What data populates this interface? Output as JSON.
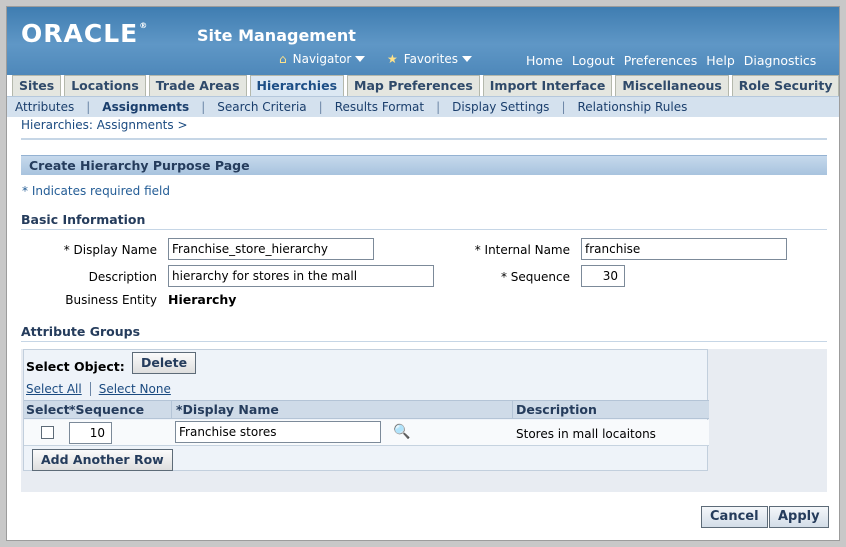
{
  "header": {
    "logo": "ORACLE",
    "logo_mark": "®",
    "app_title": "Site Management",
    "navigator": "Navigator",
    "favorites": "Favorites",
    "global_links": [
      "Home",
      "Logout",
      "Preferences",
      "Help",
      "Diagnostics"
    ]
  },
  "tabs": [
    "Sites",
    "Locations",
    "Trade Areas",
    "Hierarchies",
    "Map Preferences",
    "Import Interface",
    "Miscellaneous",
    "Role Security"
  ],
  "active_tab": "Hierarchies",
  "subnav": [
    "Attributes",
    "Assignments",
    "Search Criteria",
    "Results Format",
    "Display Settings",
    "Relationship Rules"
  ],
  "active_subnav": "Assignments",
  "breadcrumb": "Hierarchies: Assignments  >",
  "page": {
    "title": "Create Hierarchy Purpose Page",
    "required_note": "* Indicates required field"
  },
  "basic_info": {
    "section": "Basic Information",
    "display_name_label": "* Display Name",
    "display_name_value": "Franchise_store_hierarchy",
    "description_label": "Description",
    "description_value": "hierarchy for stores in the mall",
    "business_entity_label": "Business Entity",
    "business_entity_value": "Hierarchy",
    "internal_name_label": "* Internal Name",
    "internal_name_value": "franchise",
    "sequence_label": "* Sequence",
    "sequence_value": "30"
  },
  "attribute_groups": {
    "section": "Attribute Groups",
    "select_object": "Select Object:",
    "delete": "Delete",
    "select_all": "Select All",
    "select_none": "Select None",
    "columns": [
      "Select",
      "*Sequence",
      "*Display Name",
      "Description"
    ],
    "rows": [
      {
        "sequence": "10",
        "display_name": "Franchise stores",
        "description": "Stores in mall locaitons"
      }
    ],
    "add_row": "Add Another Row"
  },
  "actions": {
    "cancel": "Cancel",
    "apply": "Apply"
  }
}
